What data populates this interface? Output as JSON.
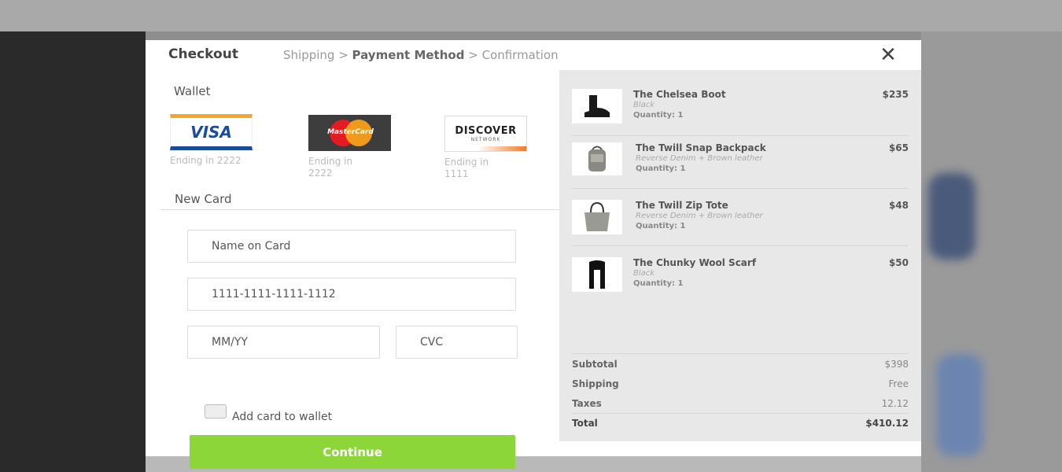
{
  "header": {
    "title": "Checkout",
    "crumb_shipping": "Shipping",
    "crumb_sep1": " > ",
    "crumb_payment": "Payment Method",
    "crumb_sep2": " > ",
    "crumb_confirmation": "Confirmation",
    "close_glyph": "✕"
  },
  "wallet": {
    "title": "Wallet",
    "cards": [
      {
        "brand": "VISA",
        "caption": "Ending in 2222"
      },
      {
        "brand": "MasterCard",
        "caption": "Ending in 2222"
      },
      {
        "brand": "DISCOVER",
        "brand_sub": "NETWORK",
        "caption": "Ending in 1111"
      }
    ]
  },
  "new_card": {
    "title": "New Card",
    "name_placeholder": "Name on Card",
    "number_value": "1111-1111-1111-1112",
    "expiry_placeholder": "MM/YY",
    "cvc_placeholder": "CVC",
    "add_to_wallet_label": "Add card to wallet",
    "continue_label": "Continue"
  },
  "cart": {
    "items": [
      {
        "name": "The Chelsea Boot",
        "variant": "Black",
        "qty": "Quantity: 1",
        "price": "$235"
      },
      {
        "name": "The Twill Snap Backpack",
        "variant": "Reverse Denim + Brown leather",
        "qty": "Quantity: 1",
        "price": "$65"
      },
      {
        "name": "The Twill Zip Tote",
        "variant": "Reverse Denim + Brown leather",
        "qty": "Quantity: 1",
        "price": "$48"
      },
      {
        "name": "The Chunky Wool Scarf",
        "variant": "Black",
        "qty": "Quantity: 1",
        "price": "$50"
      }
    ],
    "subtotal_label": "Subtotal",
    "subtotal_value": "$398",
    "shipping_label": "Shipping",
    "shipping_value": "Free",
    "taxes_label": "Taxes",
    "taxes_value": "12.12",
    "total_label": "Total",
    "total_value": "$410.12"
  },
  "colors": {
    "accent_button": "#8dd63a",
    "summary_bg": "#e8e8e8"
  }
}
